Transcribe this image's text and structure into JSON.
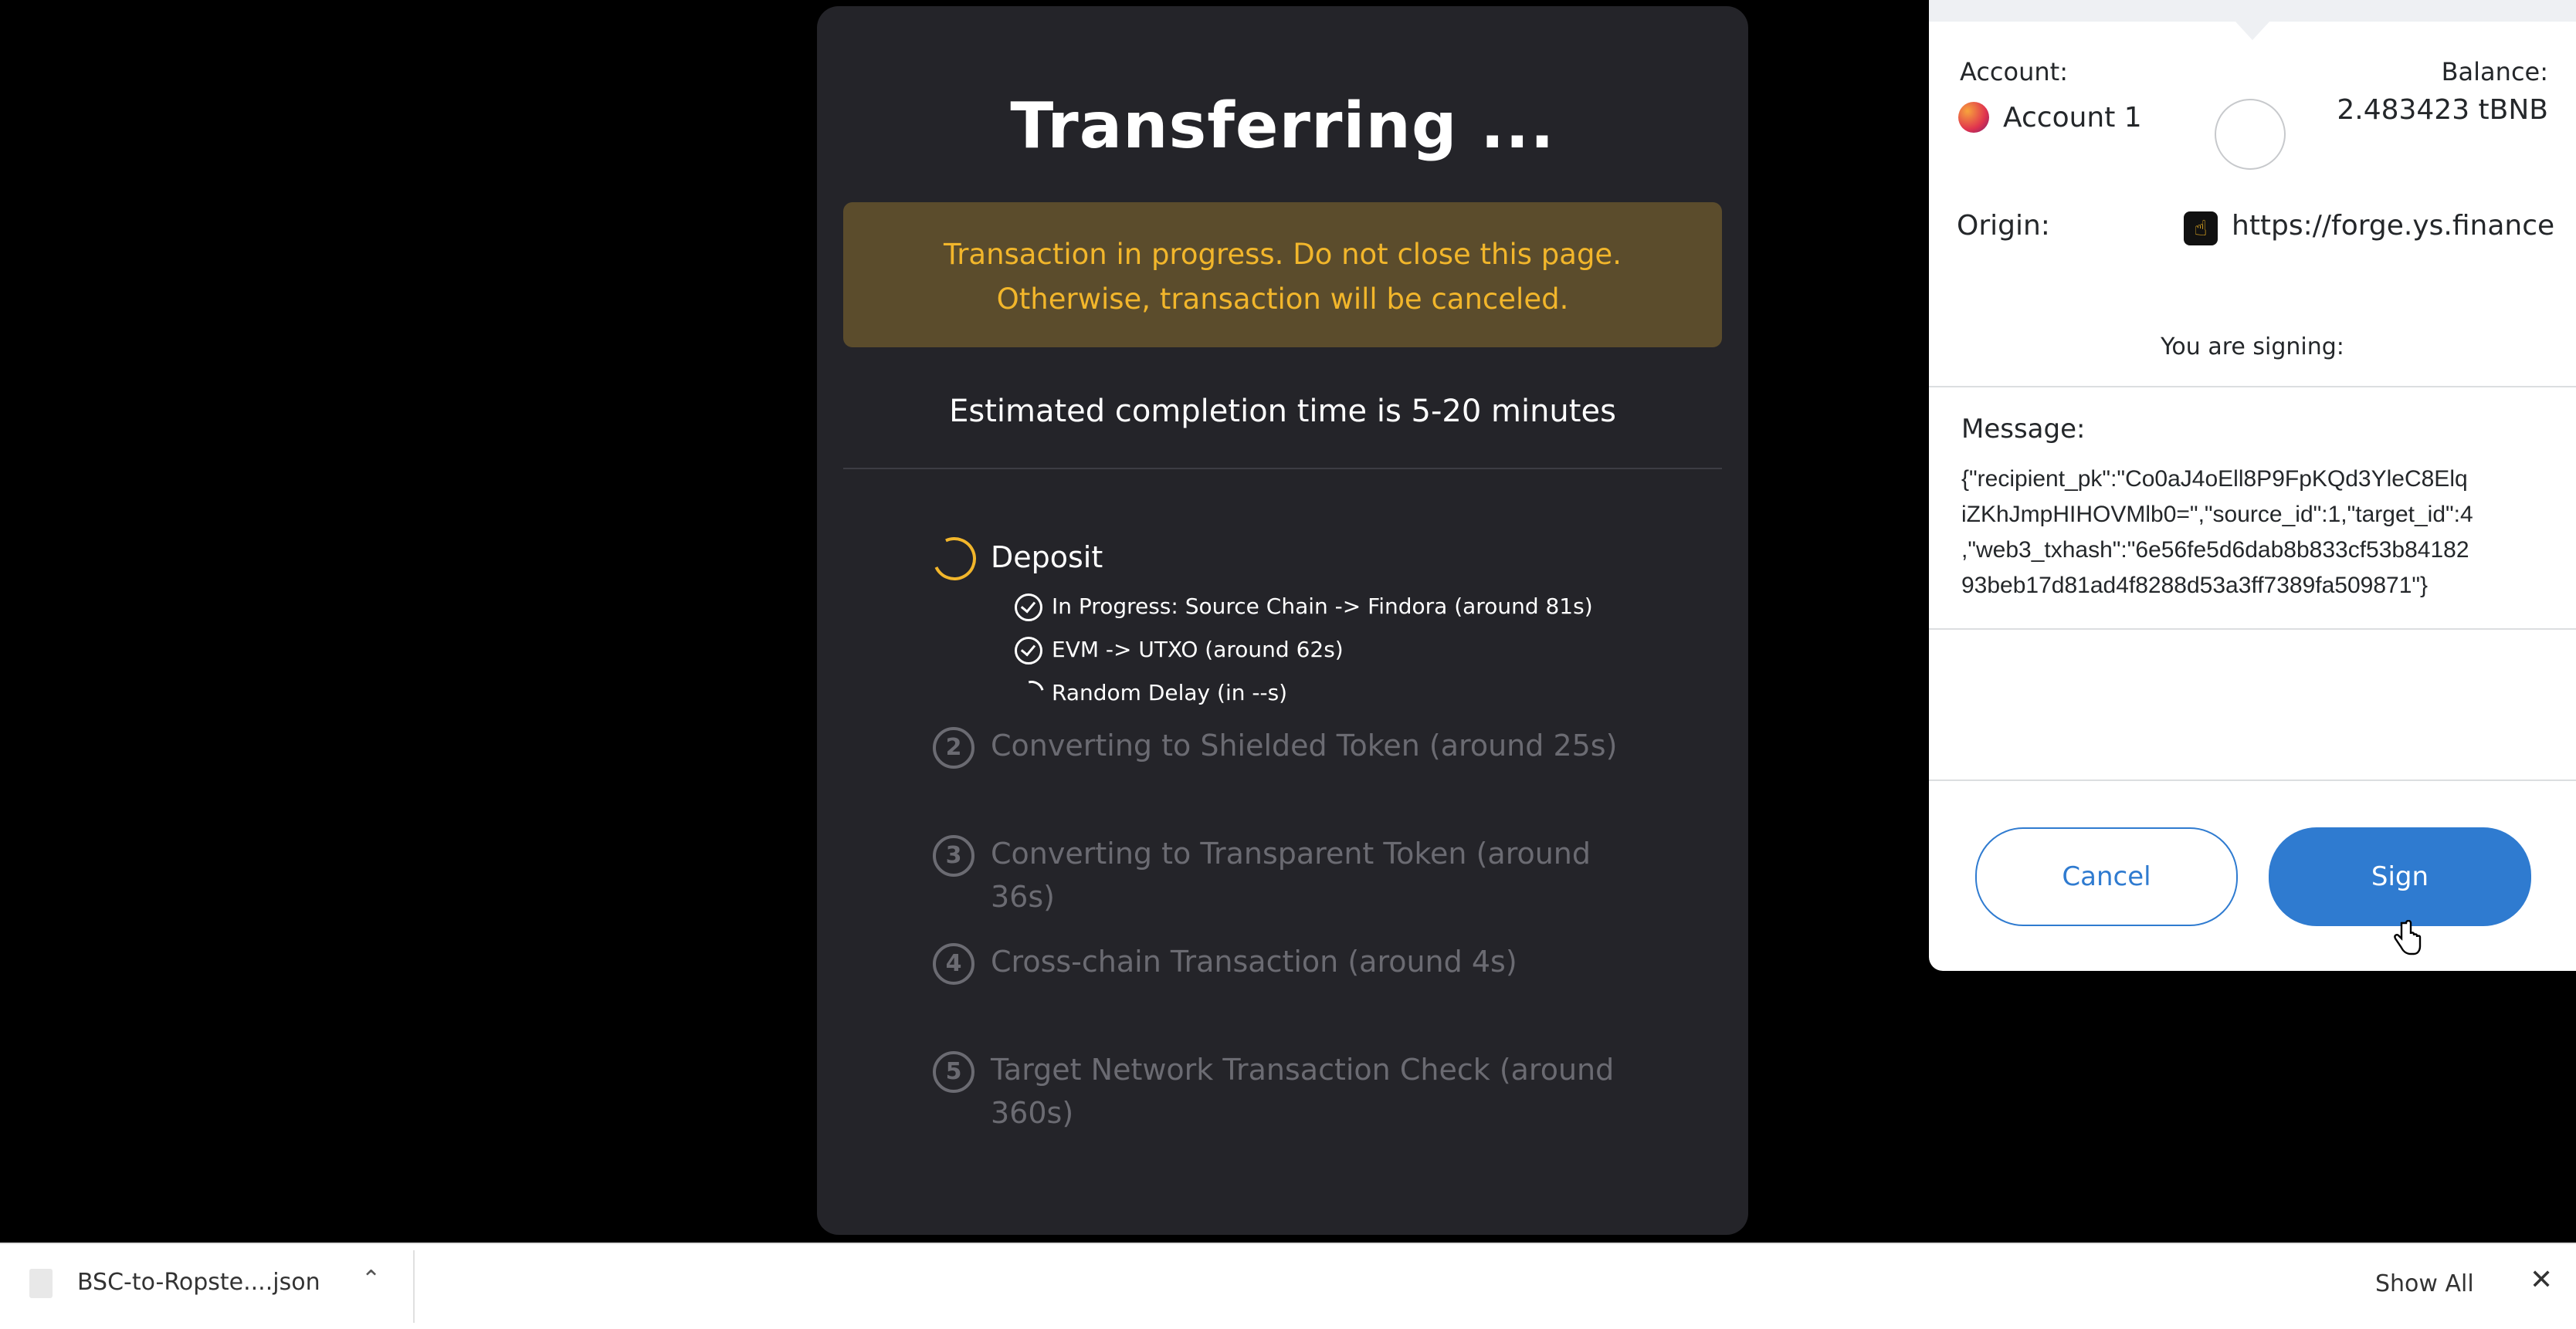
{
  "modal": {
    "title": "Transferring ...",
    "warning_line1": "Transaction in progress. Do not close this page.",
    "warning_line2": "Otherwise, transaction will be canceled.",
    "eta": "Estimated completion time is 5-20 minutes",
    "accent_color": "#f2b62b",
    "steps": [
      {
        "label": "Deposit",
        "state": "in-progress"
      },
      {
        "number": "2",
        "label": "Converting to Shielded Token  (around 25s)",
        "state": "pending"
      },
      {
        "number": "3",
        "label_line1": "Converting to Transparent Token  (around",
        "label_line2": "36s)",
        "state": "pending"
      },
      {
        "number": "4",
        "label": "Cross-chain Transaction  (around 4s)",
        "state": "pending"
      },
      {
        "number": "5",
        "label_line1": "Target Network Transaction Check  (around",
        "label_line2": "360s)",
        "state": "pending"
      }
    ],
    "substeps": [
      {
        "icon": "check-circle-icon",
        "label": "In Progress: Source Chain -> Findora  (around 81s)"
      },
      {
        "icon": "check-circle-icon",
        "label": "EVM -> UTXO  (around 62s)"
      },
      {
        "icon": "spinner-icon",
        "label": "Random Delay (in --s)"
      }
    ]
  },
  "wallet": {
    "account_label": "Account:",
    "account_name": "Account 1",
    "balance_label": "Balance:",
    "balance_value": "2.483423 tBNB",
    "origin_label": "Origin:",
    "origin_url": "https://forge.ys.finance",
    "signing_label": "You are signing:",
    "message_label": "Message:",
    "message_lines": [
      "{\"recipient_pk\":\"Co0aJ4oEll8P9FpKQd3YleC8Elq",
      "iZKhJmpHIHOVMlb0=\",\"source_id\":1,\"target_id\":4",
      ",\"web3_txhash\":\"6e56fe5d6dab8b833cf53b84182",
      "93beb17d81ad4f8288d53a3ff7389fa509871\"}"
    ],
    "cancel_label": "Cancel",
    "sign_label": "Sign",
    "brand_color": "#2f7bd0"
  },
  "downloads": {
    "file_name": "BSC-to-Ropste....json",
    "show_all_label": "Show All"
  }
}
